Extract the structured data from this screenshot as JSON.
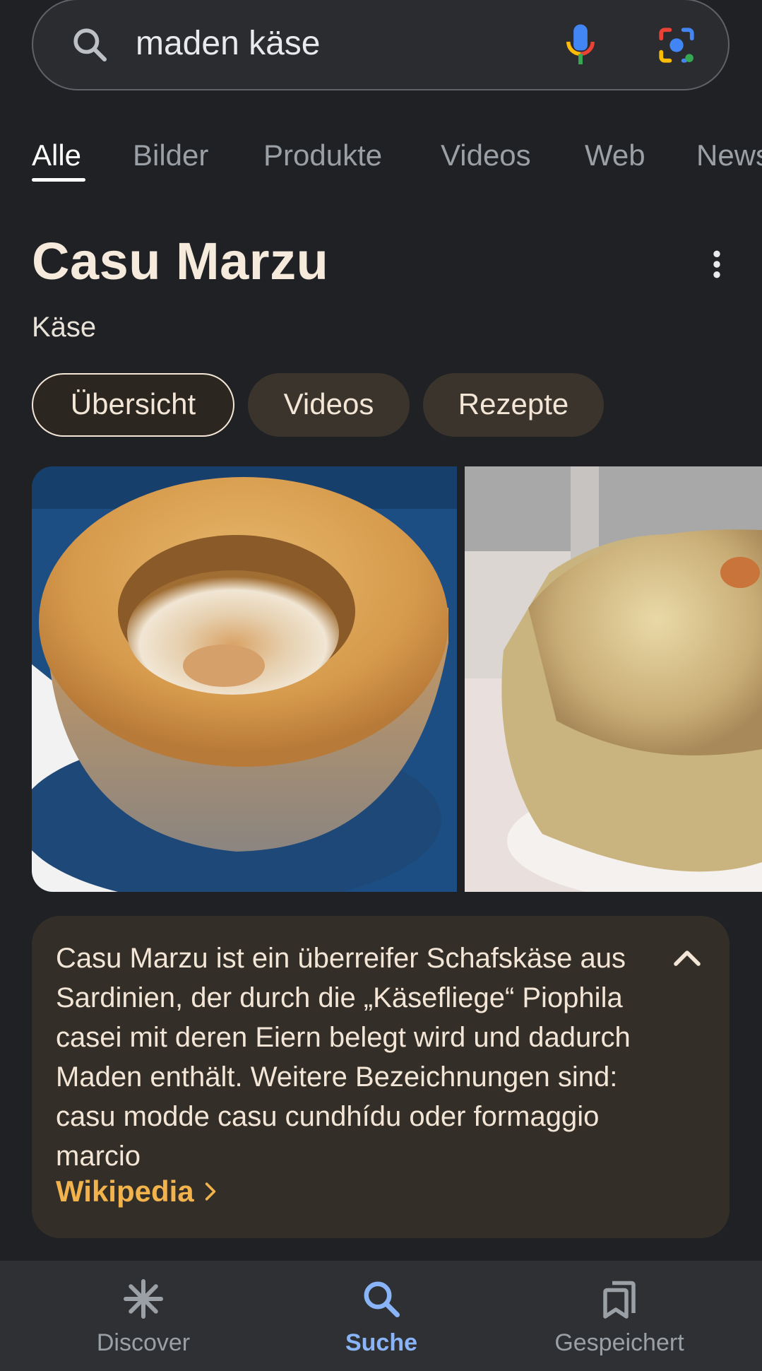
{
  "search": {
    "query": "maden käse",
    "icons": [
      "search-icon",
      "mic-icon",
      "lens-icon"
    ]
  },
  "tabs": [
    {
      "label": "Alle",
      "active": true
    },
    {
      "label": "Bilder",
      "active": false
    },
    {
      "label": "Produkte",
      "active": false
    },
    {
      "label": "Videos",
      "active": false
    },
    {
      "label": "Web",
      "active": false
    },
    {
      "label": "News",
      "active": false
    }
  ],
  "entity": {
    "title": "Casu Marzu",
    "subtitle": "Käse",
    "chips": [
      {
        "label": "Übersicht",
        "selected": true
      },
      {
        "label": "Videos",
        "selected": false
      },
      {
        "label": "Rezepte",
        "selected": false
      }
    ],
    "description": "Casu Marzu ist ein überreifer Schafskäse aus Sardinien, der durch die „Käsefliege“ Piophila casei mit deren Eiern belegt wird und dadurch Maden enthält. Weitere Bezeichnungen sind: casu modde casu cundhídu oder formaggio marcio",
    "source_link": "Wikipedia"
  },
  "bottom_nav": [
    {
      "label": "Discover",
      "icon": "asterisk-icon",
      "active": false
    },
    {
      "label": "Suche",
      "icon": "search-icon",
      "active": true
    },
    {
      "label": "Gespeichert",
      "icon": "bookmarks-icon",
      "active": false
    }
  ],
  "colors": {
    "background": "#202124",
    "accent_link": "#f2b34c",
    "active_nav": "#8ab4f8",
    "card": "#332e28"
  }
}
